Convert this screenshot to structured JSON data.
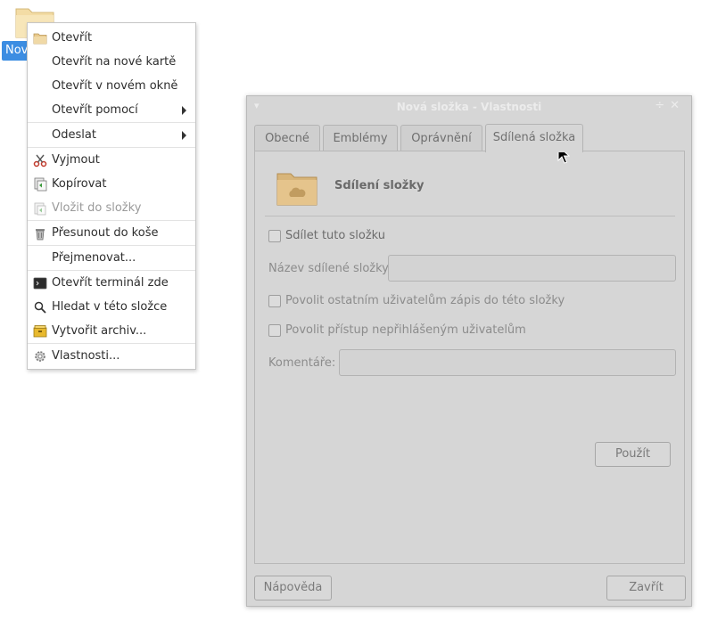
{
  "desktop": {
    "icon_label": "Nová složka"
  },
  "context_menu": {
    "items": [
      {
        "label": "Otevřít",
        "icon": "folder-icon"
      },
      {
        "label": "Otevřít na nové kartě"
      },
      {
        "label": "Otevřít v novém okně"
      },
      {
        "label": "Otevřít pomocí",
        "submenu": true
      },
      {
        "label": "Odeslat",
        "submenu": true
      },
      {
        "label": "Vyjmout",
        "icon": "scissors-icon"
      },
      {
        "label": "Kopírovat",
        "icon": "copy-icon"
      },
      {
        "label": "Vložit do složky",
        "icon": "paste-icon",
        "disabled": true
      },
      {
        "label": "Přesunout do koše",
        "icon": "trash-icon"
      },
      {
        "label": "Přejmenovat..."
      },
      {
        "label": "Otevřít terminál zde",
        "icon": "terminal-icon"
      },
      {
        "label": "Hledat v této složce",
        "icon": "search-icon"
      },
      {
        "label": "Vytvořit archiv...",
        "icon": "archive-icon"
      },
      {
        "label": "Vlastnosti...",
        "icon": "gear-icon"
      }
    ]
  },
  "dialog": {
    "title": "Nová složka - Vlastnosti",
    "tabs": [
      "Obecné",
      "Emblémy",
      "Oprávnění",
      "Sdílená složka"
    ],
    "active_tab": "Sdílená složka",
    "header_title": "Sdílení složky",
    "share_checkbox_label": "Sdílet tuto složku",
    "share_name_label": "Název sdílené složky:",
    "share_name_value": "",
    "allow_write_label": "Povolit ostatním uživatelům zápis do této složky",
    "allow_guest_label": "Povolit přístup nepřihlášeným uživatelům",
    "comment_label": "Komentáře:",
    "comment_value": "",
    "apply_button": "Použít",
    "help_button": "Nápověda",
    "close_button": "Zavřít"
  }
}
